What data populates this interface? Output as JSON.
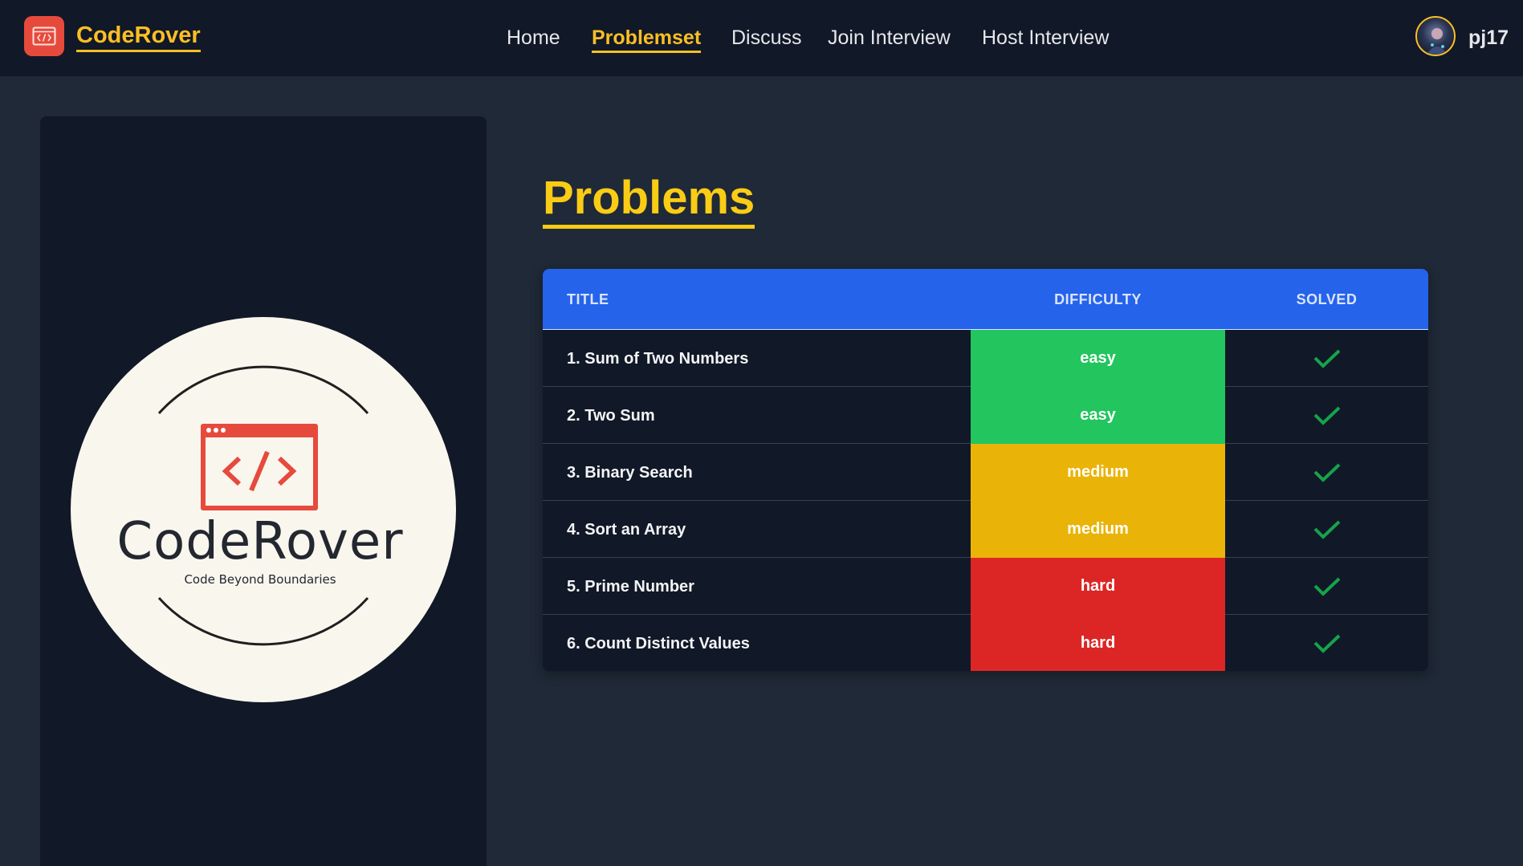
{
  "brand": {
    "name": "CodeRover",
    "logo_icon": "code-window-icon",
    "accent": "#fbbf24",
    "logo_bg": "#e64a3c"
  },
  "nav": {
    "links": [
      {
        "label": "Home",
        "active": false
      },
      {
        "label": "Problemset",
        "active": true
      },
      {
        "label": "Discuss",
        "active": false
      },
      {
        "label": "Join Interview",
        "active": false
      },
      {
        "label": "Host Interview",
        "active": false
      }
    ]
  },
  "user": {
    "name": "pj17",
    "avatar": "user-avatar"
  },
  "sidebar": {
    "logo_text": "CodeRover",
    "tagline": "Code Beyond Boundaries",
    "logo_icon": "code-window-icon"
  },
  "main": {
    "title": "Problems",
    "table": {
      "headers": {
        "title": "TITLE",
        "difficulty": "DIFFICULTY",
        "solved": "SOLVED"
      },
      "rows": [
        {
          "title": "1. Sum of Two Numbers",
          "difficulty": "easy",
          "solved": true
        },
        {
          "title": "2. Two Sum",
          "difficulty": "easy",
          "solved": true
        },
        {
          "title": "3. Binary Search",
          "difficulty": "medium",
          "solved": true
        },
        {
          "title": "4. Sort an Array",
          "difficulty": "medium",
          "solved": true
        },
        {
          "title": "5. Prime Number",
          "difficulty": "hard",
          "solved": true
        },
        {
          "title": "6. Count Distinct Values",
          "difficulty": "hard",
          "solved": true
        }
      ]
    }
  },
  "colors": {
    "easy": "#22c55e",
    "medium": "#eab308",
    "hard": "#dc2626",
    "header_bg": "#2563eb",
    "check": "#16a34a",
    "title_yellow": "#facc15"
  }
}
